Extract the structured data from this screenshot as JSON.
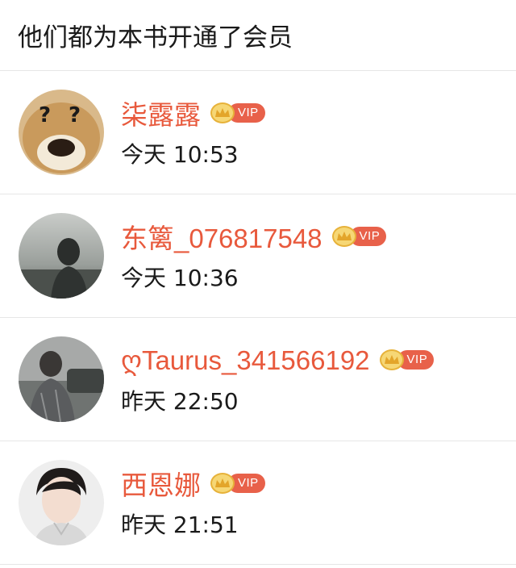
{
  "header": {
    "title": "他们都为本书开通了会员"
  },
  "members": [
    {
      "name": "柒露露",
      "time": "今天 10:53",
      "badge": "VIP"
    },
    {
      "name": "东篱_076817548",
      "time": "今天 10:36",
      "badge": "VIP"
    },
    {
      "name": "ღTaurus_341566192",
      "time": "昨天 22:50",
      "badge": "VIP"
    },
    {
      "name": "西恩娜",
      "time": "昨天 21:51",
      "badge": "VIP"
    }
  ],
  "colors": {
    "name": "#e8593c",
    "vip_badge": "#e8614a",
    "crown": "#f6d775",
    "divider": "#e6e6e6"
  },
  "icons": [
    "crown-icon"
  ]
}
